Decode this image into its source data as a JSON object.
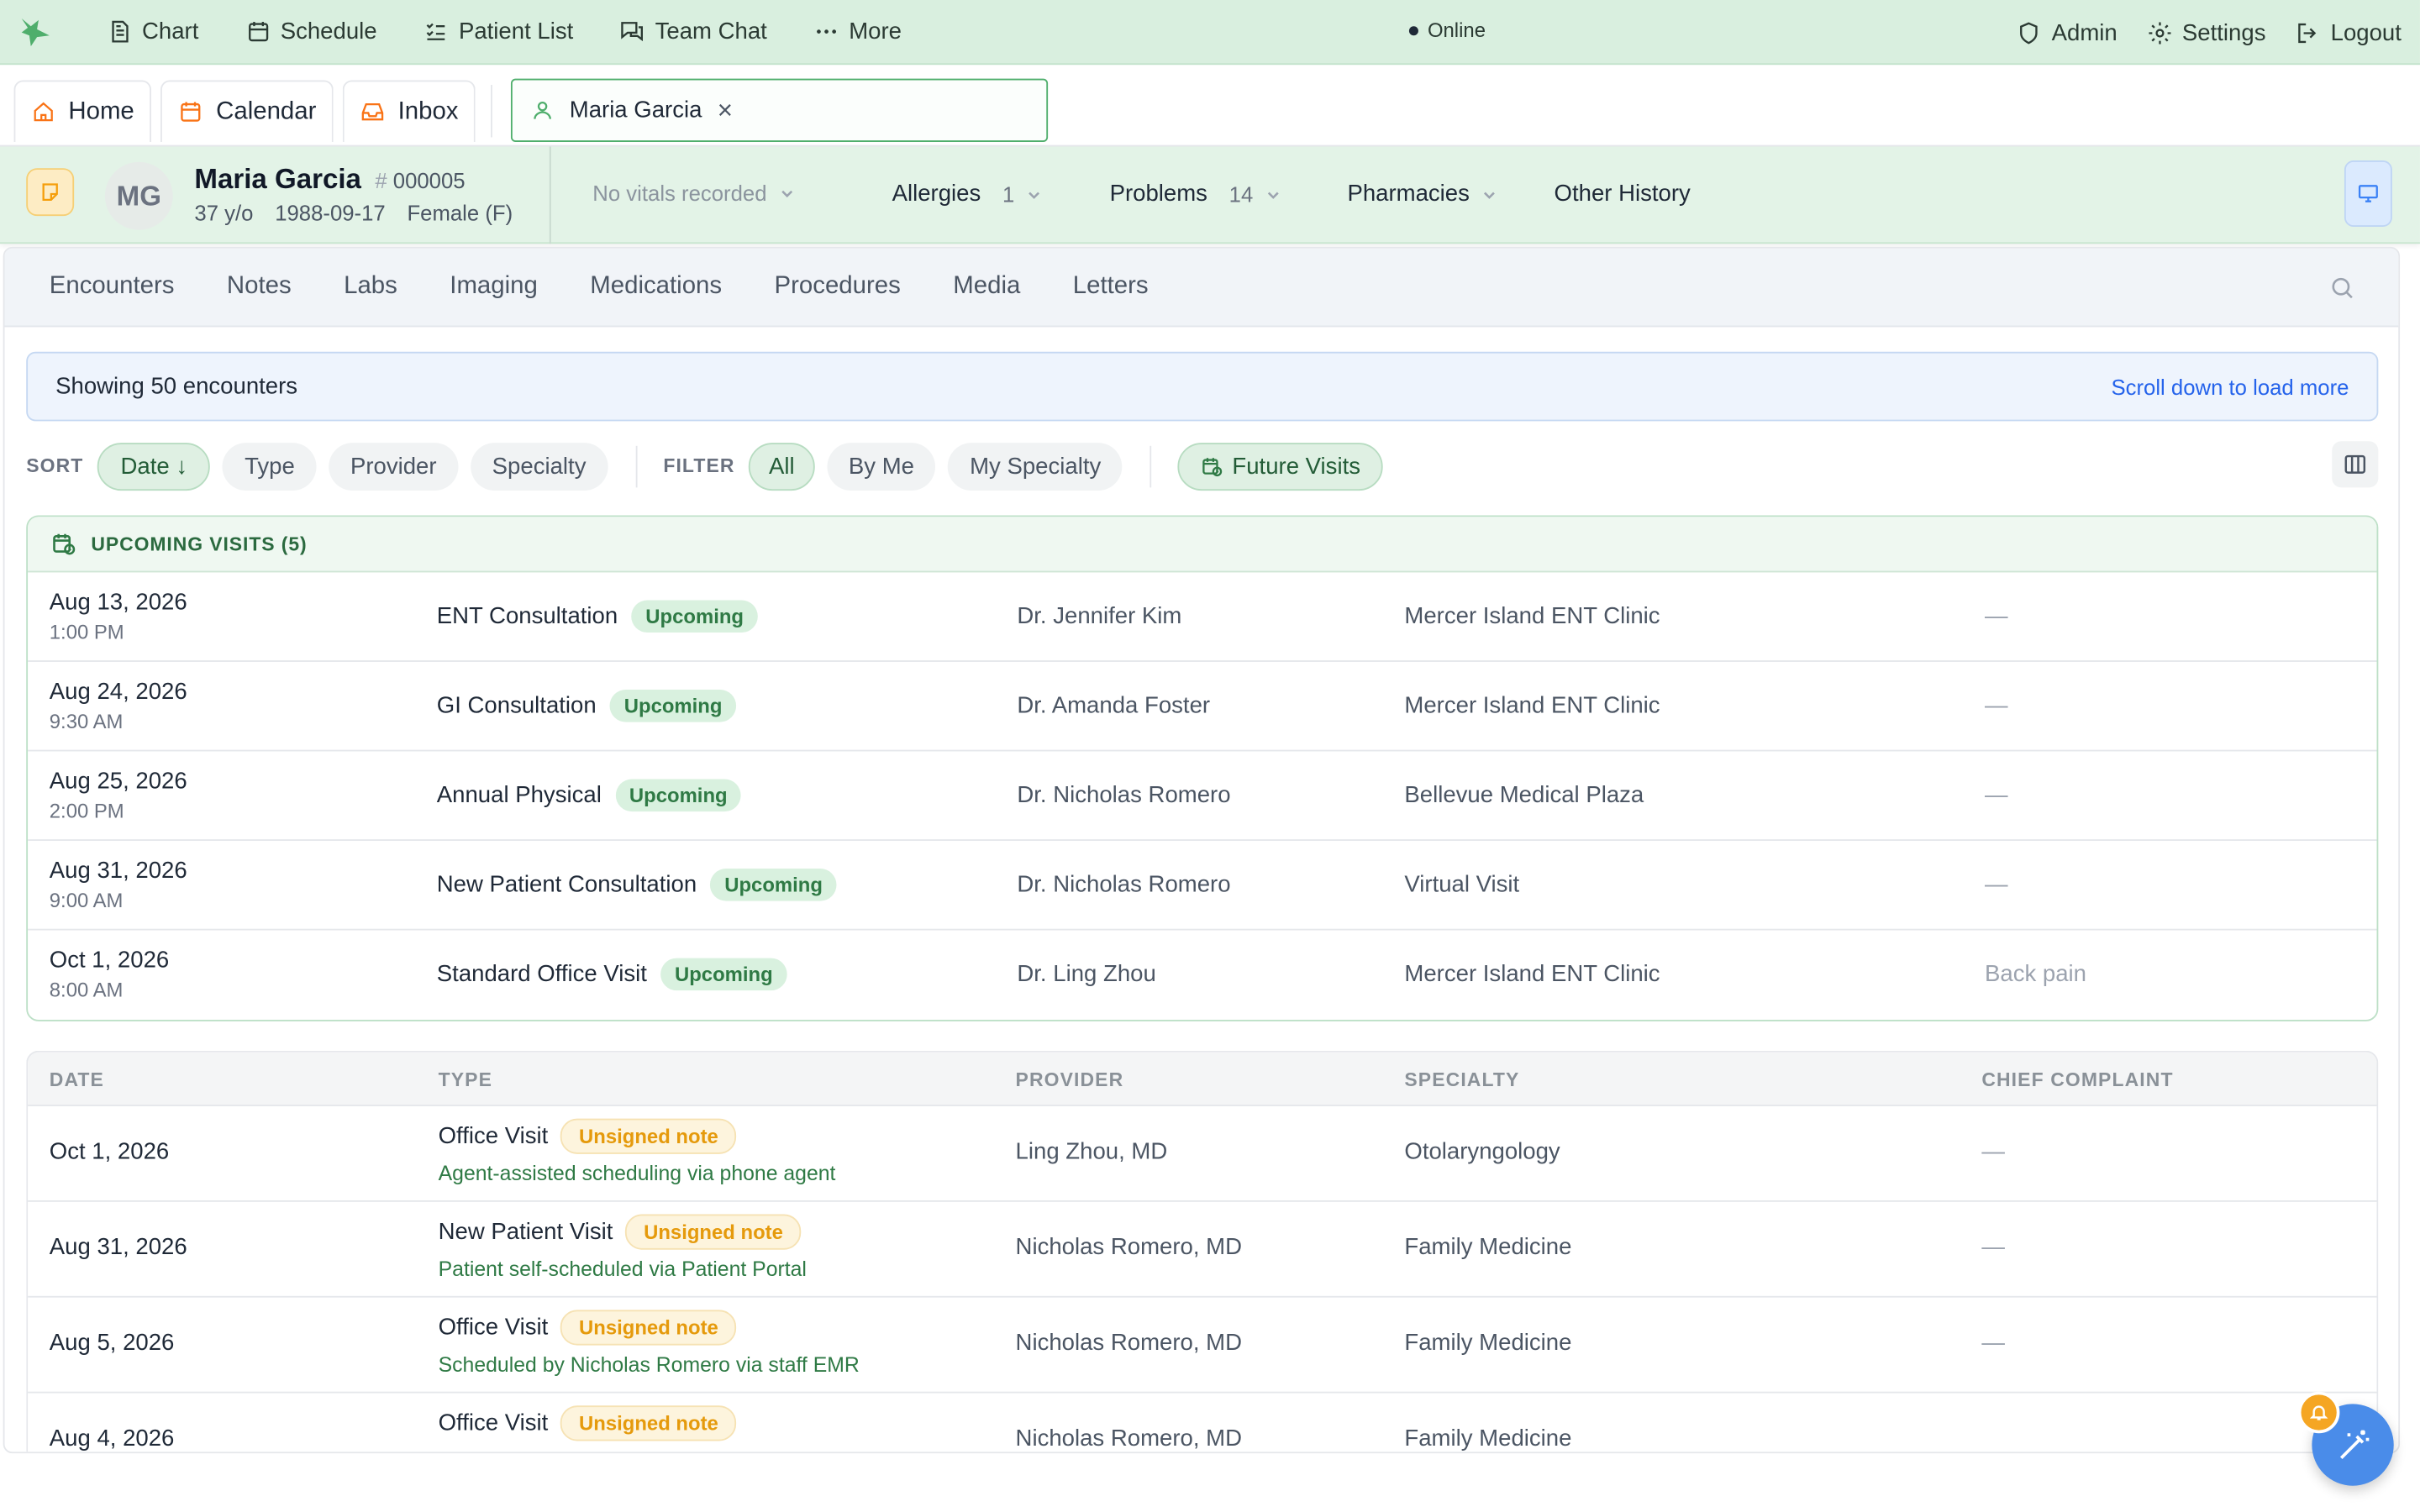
{
  "nav": {
    "items": [
      {
        "label": "Chart",
        "icon": "document-icon"
      },
      {
        "label": "Schedule",
        "icon": "calendar-icon"
      },
      {
        "label": "Patient List",
        "icon": "list-icon"
      },
      {
        "label": "Team Chat",
        "icon": "chat-icon"
      },
      {
        "label": "More",
        "icon": "ellipsis-icon"
      }
    ],
    "status": "Online",
    "right": [
      {
        "label": "Admin",
        "icon": "shield-icon"
      },
      {
        "label": "Settings",
        "icon": "gear-icon"
      },
      {
        "label": "Logout",
        "icon": "logout-icon"
      }
    ]
  },
  "tabs": {
    "home": "Home",
    "calendar": "Calendar",
    "inbox": "Inbox",
    "patient": "Maria Garcia"
  },
  "patient": {
    "initials": "MG",
    "name": "Maria Garcia",
    "id_prefix": "#",
    "id": "000005",
    "age": "37 y/o",
    "dob": "1988-09-17",
    "sex": "Female (F)",
    "vitals": "No vitals recorded",
    "allergies_label": "Allergies",
    "allergies_count": "1",
    "problems_label": "Problems",
    "problems_count": "14",
    "pharmacies_label": "Pharmacies",
    "other_history_label": "Other History"
  },
  "subtabs": [
    "Encounters",
    "Notes",
    "Labs",
    "Imaging",
    "Medications",
    "Procedures",
    "Media",
    "Letters"
  ],
  "info": {
    "showing": "Showing 50 encounters",
    "load_more": "Scroll down to load more"
  },
  "sort": {
    "label": "SORT",
    "options": [
      "Date ↓",
      "Type",
      "Provider",
      "Specialty"
    ],
    "active": 0
  },
  "filter": {
    "label": "FILTER",
    "options": [
      "All",
      "By Me",
      "My Specialty"
    ],
    "active": 0,
    "future_visits": "Future Visits"
  },
  "upcoming": {
    "title": "UPCOMING VISITS (5)",
    "badge": "Upcoming",
    "rows": [
      {
        "date": "Aug 13, 2026",
        "time": "1:00 PM",
        "type": "ENT Consultation",
        "provider": "Dr. Jennifer Kim",
        "location": "Mercer Island ENT Clinic",
        "complaint": "—"
      },
      {
        "date": "Aug 24, 2026",
        "time": "9:30 AM",
        "type": "GI Consultation",
        "provider": "Dr. Amanda Foster",
        "location": "Mercer Island ENT Clinic",
        "complaint": "—"
      },
      {
        "date": "Aug 25, 2026",
        "time": "2:00 PM",
        "type": "Annual Physical",
        "provider": "Dr. Nicholas Romero",
        "location": "Bellevue Medical Plaza",
        "complaint": "—"
      },
      {
        "date": "Aug 31, 2026",
        "time": "9:00 AM",
        "type": "New Patient Consultation",
        "provider": "Dr. Nicholas Romero",
        "location": "Virtual Visit",
        "complaint": "—"
      },
      {
        "date": "Oct 1, 2026",
        "time": "8:00 AM",
        "type": "Standard Office Visit",
        "provider": "Dr. Ling Zhou",
        "location": "Mercer Island ENT Clinic",
        "complaint": "Back pain"
      }
    ]
  },
  "table": {
    "columns": [
      "DATE",
      "TYPE",
      "PROVIDER",
      "SPECIALTY",
      "CHIEF COMPLAINT"
    ],
    "badge": "Unsigned note",
    "rows": [
      {
        "date": "Oct 1, 2026",
        "type": "Office Visit",
        "sub": "Agent-assisted scheduling via phone agent",
        "provider": "Ling Zhou, MD",
        "specialty": "Otolaryngology",
        "complaint": "—"
      },
      {
        "date": "Aug 31, 2026",
        "type": "New Patient Visit",
        "sub": "Patient self-scheduled via Patient Portal",
        "provider": "Nicholas Romero, MD",
        "specialty": "Family Medicine",
        "complaint": "—"
      },
      {
        "date": "Aug 5, 2026",
        "type": "Office Visit",
        "sub": "Scheduled by Nicholas Romero via staff EMR",
        "provider": "Nicholas Romero, MD",
        "specialty": "Family Medicine",
        "complaint": "—"
      },
      {
        "date": "Aug 4, 2026",
        "type": "Office Visit",
        "sub": "",
        "provider": "Nicholas Romero, MD",
        "specialty": "Family Medicine",
        "complaint": ""
      }
    ]
  },
  "colors": {
    "accent": "#4fae6c",
    "topbar": "#d9efdf",
    "link": "#2563eb",
    "warning": "#e59a0c"
  }
}
